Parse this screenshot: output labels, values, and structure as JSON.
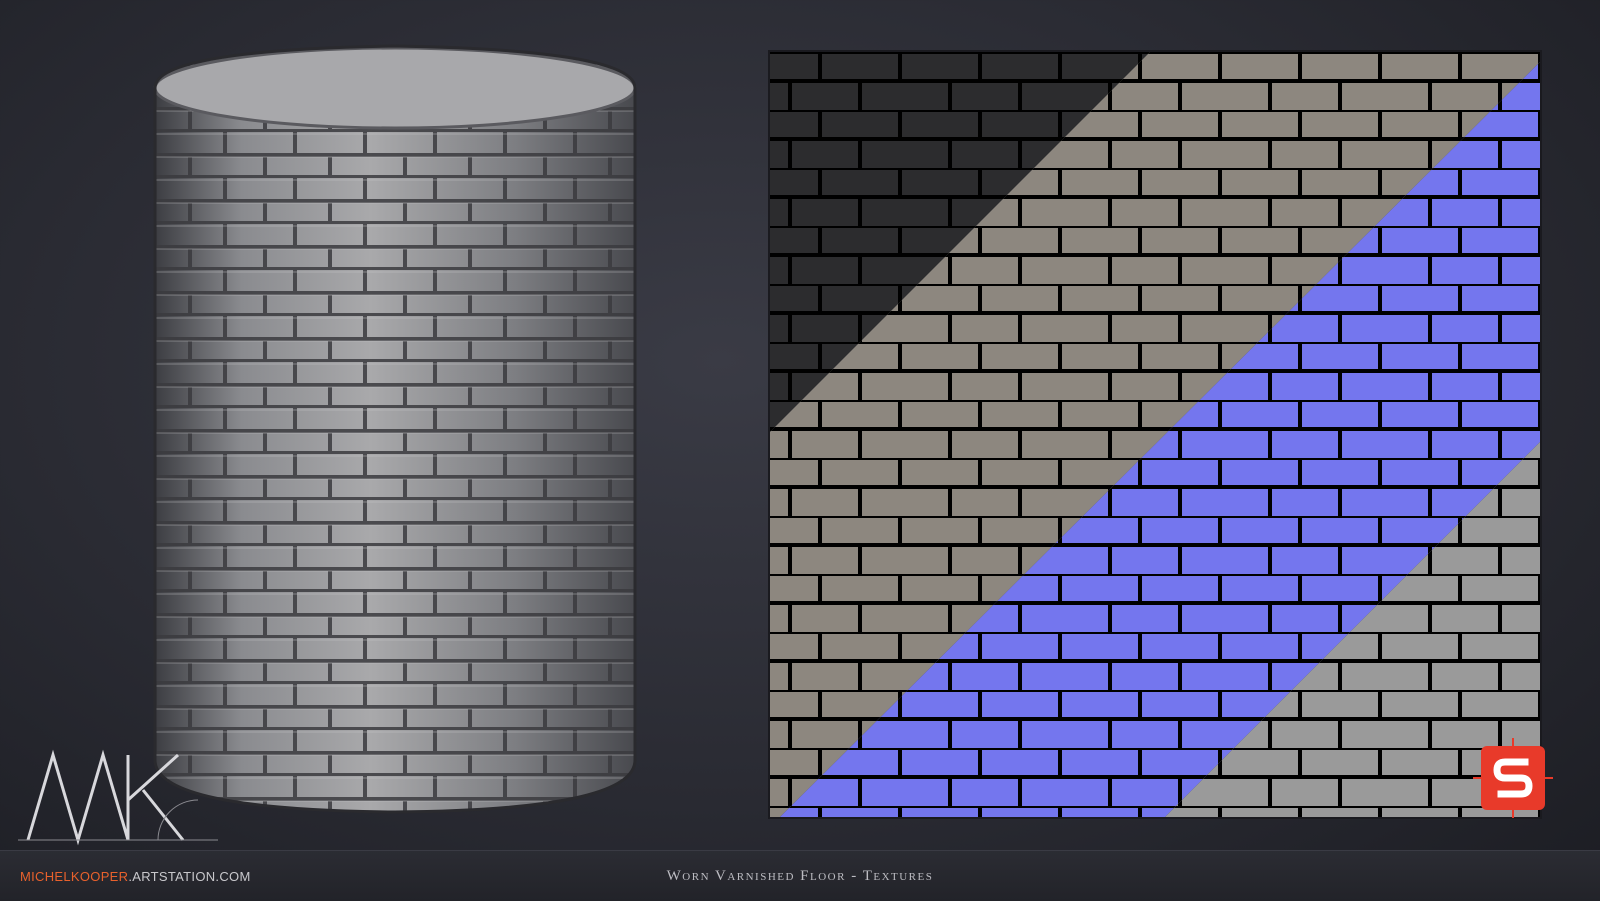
{
  "footer": {
    "url_highlight": "MICHELKOOPER",
    "url_rest": ".ARTSTATION.COM",
    "title": "Worn Varnished Floor - Textures"
  },
  "logo": {
    "name": "MK artist monogram"
  },
  "badge": {
    "name": "substance-logo",
    "letter": "S",
    "color": "#e83a2a"
  },
  "texture_maps": [
    "roughness",
    "albedo",
    "normal",
    "height"
  ],
  "colors": {
    "background": "#2d2e36",
    "stone": "#8f8e8c",
    "normal_map": "#7a7cf2",
    "accent": "#e8612c"
  },
  "icons": [
    "mk-logo-icon",
    "substance-logo-icon"
  ]
}
